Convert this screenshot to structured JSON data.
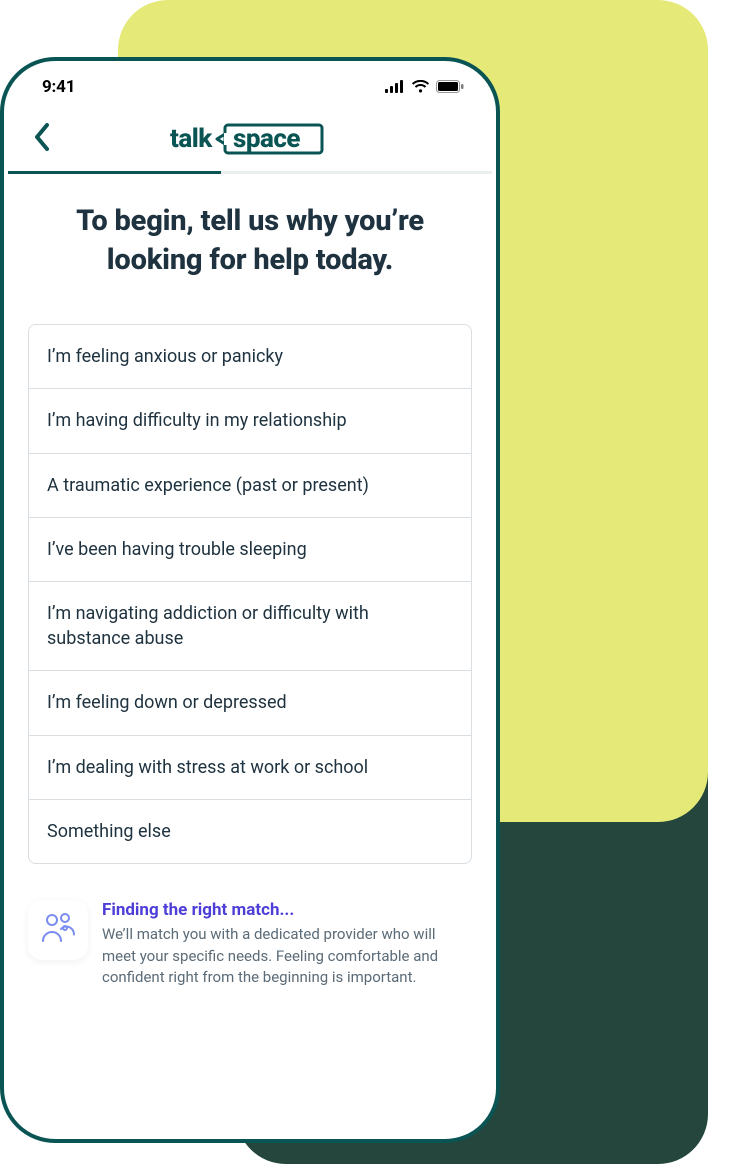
{
  "status_bar": {
    "time": "9:41"
  },
  "brand": {
    "word1": "talk",
    "word2": "space"
  },
  "progress": {
    "percent": 44
  },
  "heading": "To begin, tell us why you’re looking for help today.",
  "options": {
    "0": "I’m feeling anxious or panicky",
    "1": "I’m having difficulty in my relationship",
    "2": "A traumatic experience (past or present)",
    "3": "I’ve been having trouble sleeping",
    "4": "I’m navigating addiction or difficulty with substance abuse",
    "5": "I’m feeling down or depressed",
    "6": "I’m dealing with stress at work or school",
    "7": "Something else"
  },
  "match": {
    "title": "Finding the right match...",
    "desc": "We’ll match you with a dedicated provider who will meet your specific needs. Feeling comfortable and confident right from the beginning is important."
  }
}
